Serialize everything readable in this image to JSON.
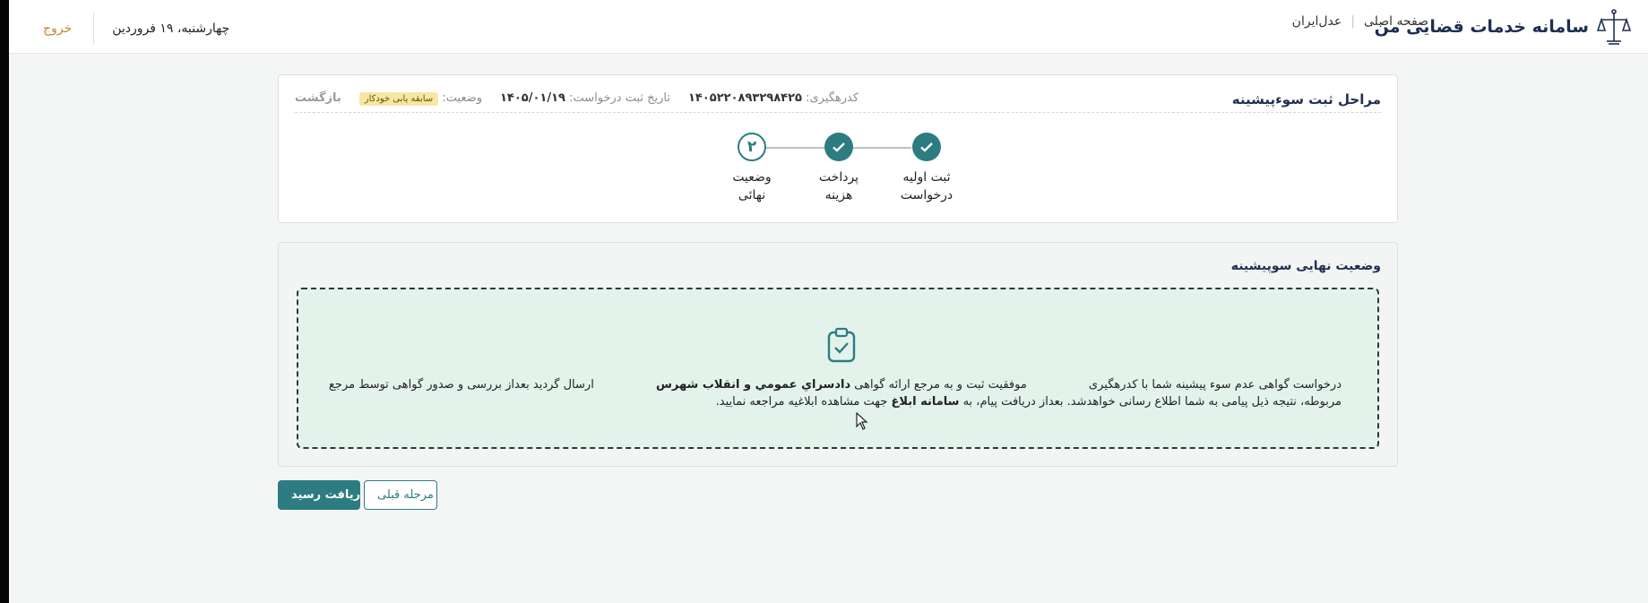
{
  "header": {
    "brand_title": "سامانه خدمات قضایی من",
    "nav": {
      "home": "صفحه اصلی",
      "adl_iran": "عدل‌ایران"
    },
    "date": "چهارشنبه، ۱۹ فروردین",
    "logout": "خروج"
  },
  "steps_card": {
    "title": "مراحل ثبت سوءپیشینه",
    "tracking_label": "کدرهگیری:",
    "tracking_value": "۱۴۰۵۲۲۰۸۹۳۲۹۸۴۲۵",
    "date_label": "تاریخ ثبت درخواست:",
    "date_value": "۱۴۰۵/۰۱/۱۹",
    "status_label": "وضعیت:",
    "status_badge": "سابقه یابی خودکار",
    "back": "بازگشت",
    "steps": [
      {
        "line1": "ثبت اولیه",
        "line2": "درخواست",
        "state": "done"
      },
      {
        "line1": "پرداخت",
        "line2": "هزینه",
        "state": "done"
      },
      {
        "line1": "وضعیت",
        "line2": "نهائی",
        "state": "pending",
        "number": "۲"
      }
    ]
  },
  "result_card": {
    "title": "وضعیت نهایی سوپیشینه",
    "msg_part1": "درخواست گواهی عدم سوء پیشینه شما با کدرهگیری",
    "msg_part2": "موفقیت ثبت و به مرجع ارائه گواهی",
    "msg_bold1": "دادسراي عمومي و انقلاب شهرس",
    "msg_part3": "ارسال گردید بعداز بررسی و صدور گواهی توسط مرجع",
    "msg_line2_part1": "مربوطه، نتیجه ذیل پیامی به شما اطلاع رسانی خواهدشد. بعداز دریافت پیام، به",
    "msg_bold2": "سامانه ابلاغ",
    "msg_line2_part2": "جهت مشاهده ابلاغیه مراجعه نمایید."
  },
  "buttons": {
    "receipt": "دریافت رسید",
    "previous": "مرحله قبلی"
  },
  "colors": {
    "primary": "#2d7c82",
    "title": "#1f2f52",
    "logout": "#c0882a",
    "success_bg": "#e3f3ec",
    "badge_bg": "#f7e7a4"
  }
}
